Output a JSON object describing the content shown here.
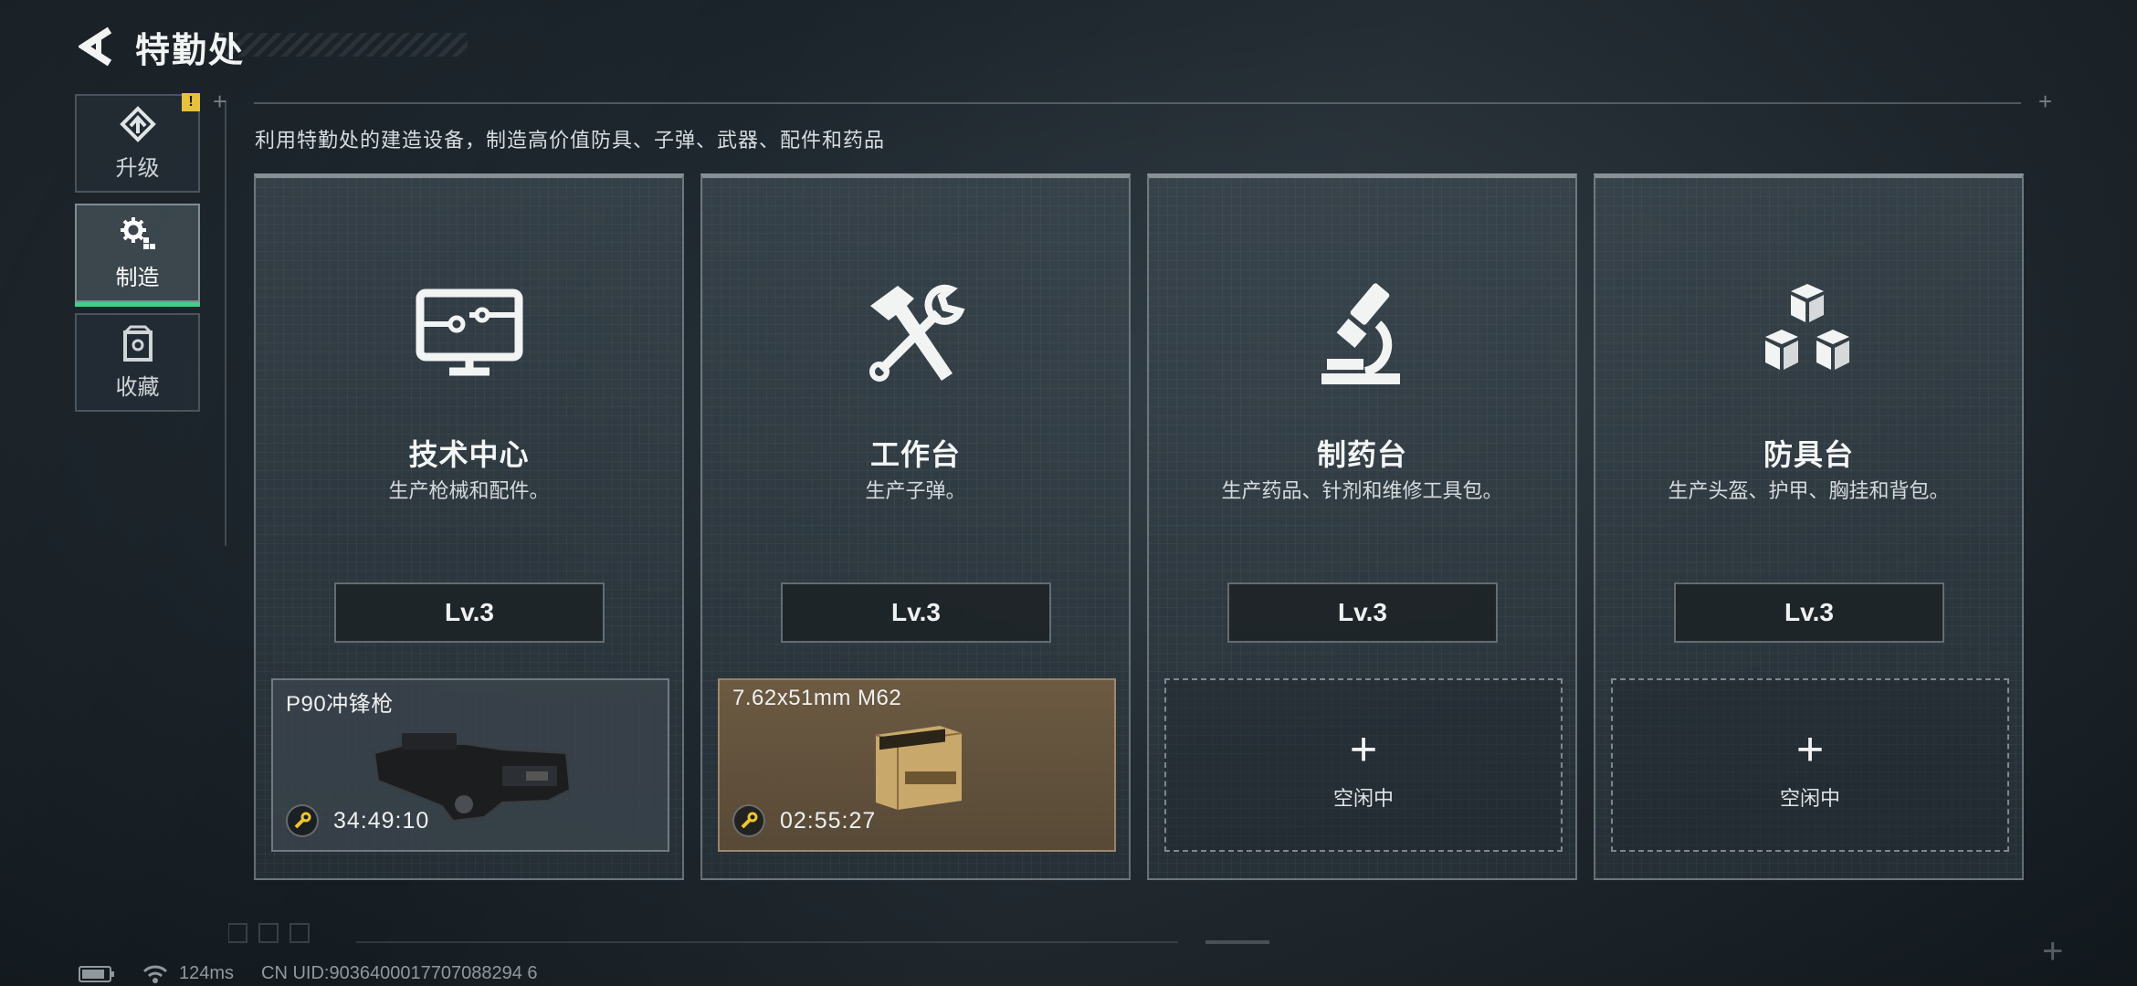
{
  "header": {
    "title": "特勤处",
    "back_icon": "back-arrow-icon"
  },
  "sidebar": {
    "items": [
      {
        "label": "升级",
        "icon": "upgrade-icon",
        "active": false,
        "badge": "!"
      },
      {
        "label": "制造",
        "icon": "gears-icon",
        "active": true
      },
      {
        "label": "收藏",
        "icon": "collection-icon",
        "active": false
      }
    ]
  },
  "subtitle": "利用特勤处的建造设备，制造高价值防具、子弹、武器、配件和药品",
  "stations": [
    {
      "name": "技术中心",
      "desc": "生产枪械和配件。",
      "icon": "monitor-circuit-icon",
      "level": "Lv.3",
      "slot": {
        "status": "crafting",
        "item": "P90冲锋枪",
        "timer": "34:49:10"
      }
    },
    {
      "name": "工作台",
      "desc": "生产子弹。",
      "icon": "hammer-wrench-icon",
      "level": "Lv.3",
      "slot": {
        "status": "crafting",
        "item": "7.62x51mm M62",
        "timer": "02:55:27"
      }
    },
    {
      "name": "制药台",
      "desc": "生产药品、针剂和维修工具包。",
      "icon": "microscope-icon",
      "level": "Lv.3",
      "slot": {
        "status": "idle",
        "label": "空闲中"
      }
    },
    {
      "name": "防具台",
      "desc": "生产头盔、护甲、胸挂和背包。",
      "icon": "cubes-icon",
      "level": "Lv.3",
      "slot": {
        "status": "idle",
        "label": "空闲中"
      }
    }
  ],
  "status_bar": {
    "ping": "124ms",
    "uid": "CN UID:9036400017707088294 6"
  },
  "colors": {
    "accent_green": "#3fcf8b",
    "badge_yellow": "#e7c13b"
  }
}
